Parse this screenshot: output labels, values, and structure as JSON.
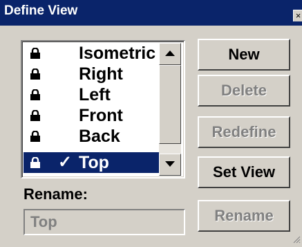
{
  "window": {
    "title": "Define View",
    "close_glyph": "×"
  },
  "views": {
    "items": [
      {
        "label": "Isometric",
        "icon": "lock-icon",
        "checked": false,
        "selected": false
      },
      {
        "label": "Right",
        "icon": "lock-icon",
        "checked": false,
        "selected": false
      },
      {
        "label": "Left",
        "icon": "lock-icon",
        "checked": false,
        "selected": false
      },
      {
        "label": "Front",
        "icon": "lock-icon",
        "checked": false,
        "selected": false
      },
      {
        "label": "Back",
        "icon": "lock-icon",
        "checked": false,
        "selected": false
      },
      {
        "label": "Top",
        "icon": "lock-icon",
        "checked": true,
        "selected": true
      }
    ],
    "check_glyph": "✓"
  },
  "rename": {
    "label": "Rename:",
    "value": "Top"
  },
  "buttons": {
    "new": "New",
    "delete": "Delete",
    "redefine": "Redefine",
    "set_view": "Set View",
    "rename": "Rename"
  },
  "colors": {
    "title_bar": "#0a246a",
    "selection": "#0a246a",
    "face": "#d4d0c8"
  }
}
